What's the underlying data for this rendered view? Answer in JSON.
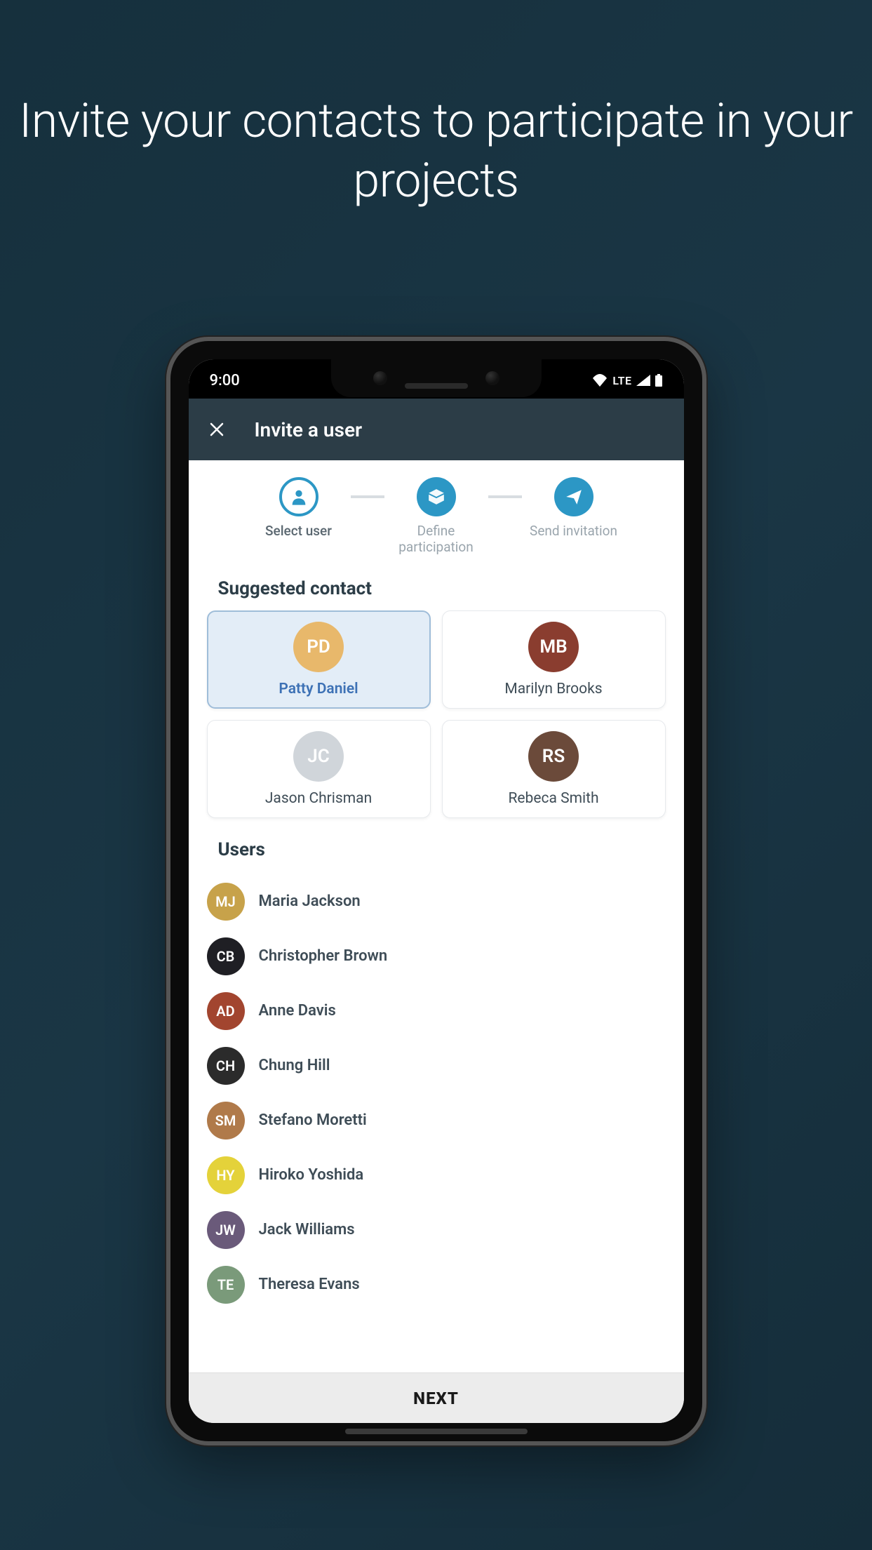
{
  "promo": {
    "headline": "Invite your contacts to participate in your projects"
  },
  "statusbar": {
    "time": "9:00",
    "network": "LTE"
  },
  "appbar": {
    "title": "Invite a user"
  },
  "steps": {
    "items": [
      {
        "label": "Select user"
      },
      {
        "label": "Define participation"
      },
      {
        "label": "Send invitation"
      }
    ]
  },
  "sections": {
    "suggested_title": "Suggested contact",
    "users_title": "Users"
  },
  "suggested": [
    {
      "name": "Patty Daniel",
      "avatar_bg": "#e8b86b",
      "selected": true
    },
    {
      "name": "Marilyn Brooks",
      "avatar_bg": "#8a3d2f",
      "selected": false
    },
    {
      "name": "Jason Chrisman",
      "avatar_bg": "#d0d5da",
      "selected": false
    },
    {
      "name": "Rebeca Smith",
      "avatar_bg": "#6b4a3a",
      "selected": false
    }
  ],
  "users": [
    {
      "name": "Maria Jackson",
      "avatar_bg": "#c7a24a"
    },
    {
      "name": "Christopher Brown",
      "avatar_bg": "#1f1f24"
    },
    {
      "name": "Anne Davis",
      "avatar_bg": "#a2452f"
    },
    {
      "name": "Chung Hill",
      "avatar_bg": "#2b2b2b"
    },
    {
      "name": "Stefano Moretti",
      "avatar_bg": "#b07a4a"
    },
    {
      "name": "Hiroko Yoshida",
      "avatar_bg": "#e4d23a"
    },
    {
      "name": "Jack Williams",
      "avatar_bg": "#6a5a7a"
    },
    {
      "name": "Theresa Evans",
      "avatar_bg": "#7a9a7a"
    }
  ],
  "footer": {
    "next": "NEXT"
  },
  "colors": {
    "accent": "#2c97c5",
    "appbar": "#2c3d47"
  }
}
